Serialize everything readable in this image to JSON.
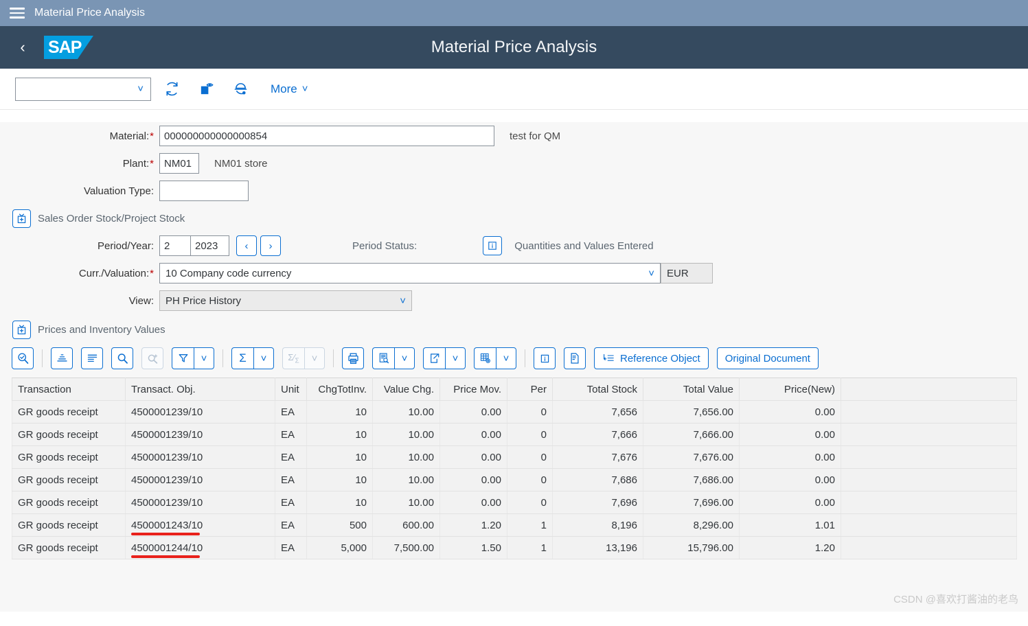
{
  "topbar": {
    "title": "Material Price Analysis",
    "menu_icon": "hamburger-icon"
  },
  "shellbar": {
    "title": "Material Price Analysis",
    "logo_text": "SAP",
    "back_icon": "chevron-left-icon"
  },
  "actionbar": {
    "variant_value": "",
    "refresh_label": "refresh-icon",
    "display_label": "display-document-icon",
    "settings_label": "maintenance-icon",
    "more_label": "More"
  },
  "form": {
    "material_label": "Material:",
    "material_value": "000000000000000854",
    "material_desc": "test for QM",
    "plant_label": "Plant:",
    "plant_value": "NM01",
    "plant_desc": "NM01 store",
    "valuation_type_label": "Valuation Type:",
    "valuation_type_value": "",
    "sales_order_section": "Sales Order Stock/Project Stock",
    "period_year_label": "Period/Year:",
    "period_value": "2",
    "year_value": "2023",
    "period_status_label": "Period Status:",
    "period_status_value": "Quantities and Values Entered",
    "curr_valuation_label": "Curr./Valuation:",
    "curr_valuation_value": "10 Company code currency",
    "currency_value": "EUR",
    "view_label": "View:",
    "view_value": "PH Price History",
    "prices_section": "Prices and Inventory Values"
  },
  "gridbar": {
    "buttons": [
      {
        "name": "search-check-icon",
        "label": ""
      },
      {
        "name": "sort-icon",
        "label": ""
      },
      {
        "name": "layout-lines-icon",
        "label": ""
      },
      {
        "name": "search-icon",
        "label": ""
      },
      {
        "name": "search-plus-icon",
        "label": ""
      },
      {
        "name": "filter-icon",
        "label": ""
      },
      {
        "name": "sum-icon",
        "label": ""
      },
      {
        "name": "subtotal-icon",
        "label": ""
      },
      {
        "name": "print-icon",
        "label": ""
      },
      {
        "name": "view-detail-icon",
        "label": ""
      },
      {
        "name": "export-icon",
        "label": ""
      },
      {
        "name": "table-settings-icon",
        "label": ""
      },
      {
        "name": "info-icon",
        "label": ""
      },
      {
        "name": "notes-icon",
        "label": ""
      }
    ],
    "reference_object_label": "Reference Object",
    "original_document_label": "Original Document"
  },
  "table": {
    "columns": [
      "Transaction",
      "Transact. Obj.",
      "Unit",
      "ChgTotInv.",
      "Value Chg.",
      "Price Mov.",
      "Per",
      "Total Stock",
      "Total Value",
      "Price(New)"
    ],
    "rows": [
      {
        "transaction": "GR goods receipt",
        "object": "4500001239/10",
        "unit": "EA",
        "chg_tot_inv": "10",
        "value_chg": "10.00",
        "price_mov": "0.00",
        "per": "0",
        "total_stock": "7,656",
        "total_value": "7,656.00",
        "price_new": "0.00",
        "underlined": false
      },
      {
        "transaction": "GR goods receipt",
        "object": "4500001239/10",
        "unit": "EA",
        "chg_tot_inv": "10",
        "value_chg": "10.00",
        "price_mov": "0.00",
        "per": "0",
        "total_stock": "7,666",
        "total_value": "7,666.00",
        "price_new": "0.00",
        "underlined": false
      },
      {
        "transaction": "GR goods receipt",
        "object": "4500001239/10",
        "unit": "EA",
        "chg_tot_inv": "10",
        "value_chg": "10.00",
        "price_mov": "0.00",
        "per": "0",
        "total_stock": "7,676",
        "total_value": "7,676.00",
        "price_new": "0.00",
        "underlined": false
      },
      {
        "transaction": "GR goods receipt",
        "object": "4500001239/10",
        "unit": "EA",
        "chg_tot_inv": "10",
        "value_chg": "10.00",
        "price_mov": "0.00",
        "per": "0",
        "total_stock": "7,686",
        "total_value": "7,686.00",
        "price_new": "0.00",
        "underlined": false
      },
      {
        "transaction": "GR goods receipt",
        "object": "4500001239/10",
        "unit": "EA",
        "chg_tot_inv": "10",
        "value_chg": "10.00",
        "price_mov": "0.00",
        "per": "0",
        "total_stock": "7,696",
        "total_value": "7,696.00",
        "price_new": "0.00",
        "underlined": false
      },
      {
        "transaction": "GR goods receipt",
        "object": "4500001243/10",
        "unit": "EA",
        "chg_tot_inv": "500",
        "value_chg": "600.00",
        "price_mov": "1.20",
        "per": "1",
        "total_stock": "8,196",
        "total_value": "8,296.00",
        "price_new": "1.01",
        "underlined": true
      },
      {
        "transaction": "GR goods receipt",
        "object": "4500001244/10",
        "unit": "EA",
        "chg_tot_inv": "5,000",
        "value_chg": "7,500.00",
        "price_mov": "1.50",
        "per": "1",
        "total_stock": "13,196",
        "total_value": "15,796.00",
        "price_new": "1.20",
        "underlined": true
      }
    ]
  },
  "watermark": "CSDN @喜欢打酱油的老鸟",
  "colors": {
    "accent": "#0a6ed1",
    "shell": "#354a5f",
    "topbar": "#7a95b4",
    "required": "#bb0000",
    "annotation": "#e8211b"
  }
}
